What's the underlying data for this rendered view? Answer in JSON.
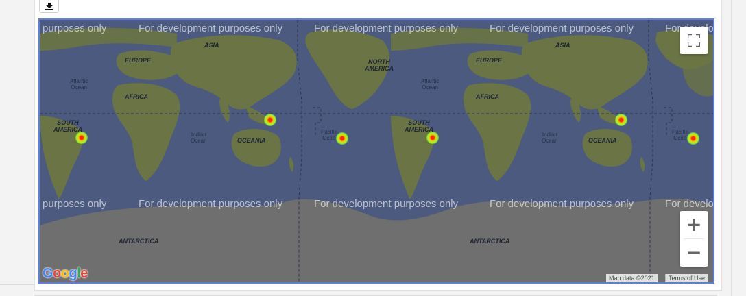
{
  "toolbar": {
    "download_icon": "download-icon"
  },
  "map": {
    "watermark": "For development purposes only",
    "watermark_partial_left": "purposes only",
    "watermark_partial_right": "For develo",
    "labels": {
      "asia": "ASIA",
      "europe": "EUROPE",
      "africa": "AFRICA",
      "south_america": "SOUTH\nAMERICA",
      "north_america": "NORTH\nAMERICA",
      "oceania": "OCEANIA",
      "antarctica": "ANTARCTICA",
      "atlantic": "Atlantic\nOcean",
      "indian": "Indian\nOcean",
      "pacific": "Pacific\nOcea"
    },
    "controls": {
      "fullscreen_icon": "fullscreen-icon",
      "zoom_in": "+",
      "zoom_out": "−"
    },
    "attribution": {
      "map_data": "Map data ©2021",
      "terms": "Terms of Use",
      "logo": "Google"
    },
    "colors": {
      "ocean": "#4b5a7e",
      "land": "#6b7444",
      "ice": "#6f6f6f",
      "border": "#5b7ee5"
    }
  }
}
